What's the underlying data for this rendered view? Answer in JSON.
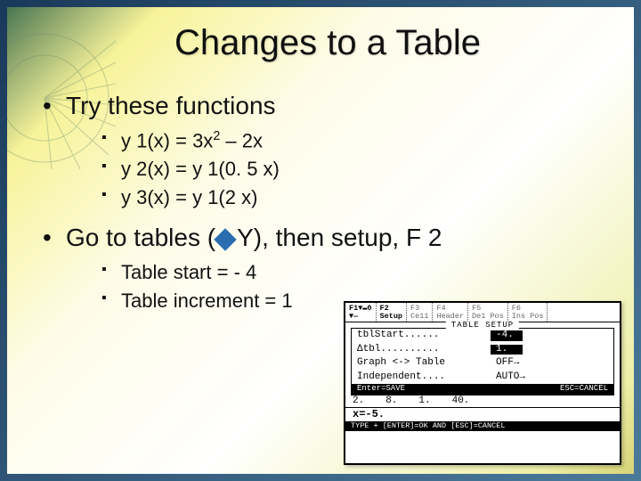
{
  "title": "Changes to a Table",
  "bullets": {
    "b1": "Try these functions",
    "b1_items": {
      "i1_pre": "y 1(x) = 3x",
      "i1_sup": "2",
      "i1_post": " – 2x",
      "i2": "y 2(x) = y 1(0. 5 x)",
      "i3": "y 3(x) = y 1(2 x)"
    },
    "b2_pre": "Go to tables (",
    "b2_post": "Y), then setup, F 2",
    "b2_items": {
      "i1": "Table start = - 4",
      "i2": "Table increment = 1"
    }
  },
  "calc": {
    "tabs": {
      "t1_top": "F1▼▬0",
      "t1_bot": "▼—",
      "t2_top": "F2",
      "t2_bot": "Setup",
      "t3_top": "F3",
      "t3_bot": "Ce11",
      "t4_top": "F4",
      "t4_bot": "Header",
      "t5_top": "F5",
      "t5_bot": "De1 Pos",
      "t6_top": "F6",
      "t6_bot": "Ins Pos"
    },
    "dialog_title": "TABLE SETUP",
    "lines": {
      "l1_lbl": "tblStart...... ",
      "l1_val": "-4.",
      "l2_lbl": "Δtbl.......... ",
      "l2_val": "1.",
      "l3_lbl": "Graph <-> Table",
      "l3_val": "OFF→",
      "l4_lbl": "Independent....",
      "l4_val": "AUTO→"
    },
    "foot_left": "Enter=SAVE",
    "foot_right": "ESC=CANCEL",
    "row": {
      "c1": "2.",
      "c2": "8.",
      "c3": "1.",
      "c4": "40."
    },
    "xline": "x=-5.",
    "status": "TYPE + [ENTER]=OK AND [ESC]=CANCEL"
  }
}
